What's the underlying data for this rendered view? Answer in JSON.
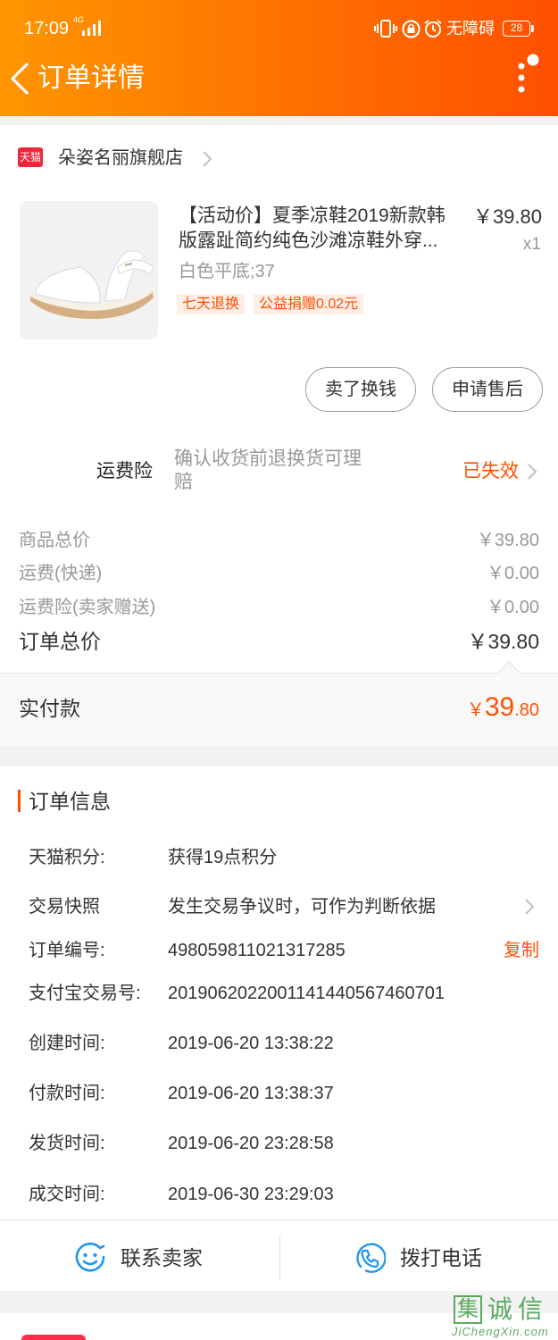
{
  "status_bar": {
    "time": "17:09",
    "network": "4G",
    "accessibility": "无障碍",
    "battery": "28"
  },
  "header": {
    "title": "订单详情",
    "back_icon": "chevron-left-icon",
    "more_icon": "more-vertical-icon"
  },
  "store": {
    "badge": "天猫",
    "name": "朵姿名丽旗舰店"
  },
  "product": {
    "title": "【活动价】夏季凉鞋2019新款韩版露趾简约纯色沙滩凉鞋外穿...",
    "price": "￥39.80",
    "quantity": "x1",
    "sku": "白色平底;37",
    "tags": [
      "七天退换",
      "公益捐赠0.02元"
    ]
  },
  "actions": {
    "resell": "卖了换钱",
    "after_sale": "申请售后"
  },
  "shipping_insurance": {
    "label": "运费险",
    "description": "确认收货前退换货可理赔",
    "status": "已失效"
  },
  "price_summary": {
    "rows": [
      {
        "label": "商品总价",
        "value": "￥39.80"
      },
      {
        "label": "运费(快递)",
        "value": "￥0.00"
      },
      {
        "label": "运费险(卖家赠送)",
        "value": "￥0.00"
      }
    ],
    "total_label": "订单总价",
    "total_value": "￥39.80"
  },
  "payment": {
    "label": "实付款",
    "currency": "￥",
    "integer": "39",
    "decimal": ".80"
  },
  "order_info": {
    "title": "订单信息",
    "rows": [
      {
        "label": "天猫积分:",
        "value": "获得19点积分"
      },
      {
        "label": "交易快照",
        "value": "发生交易争议时，可作为判断依据"
      },
      {
        "label": "订单编号:",
        "value": "498059811021317285"
      },
      {
        "label": "支付宝交易号:",
        "value": "2019062022001141440567460701"
      },
      {
        "label": "创建时间:",
        "value": "2019-06-20 13:38:22"
      },
      {
        "label": "付款时间:",
        "value": "2019-06-20 13:38:37"
      },
      {
        "label": "发货时间:",
        "value": "2019-06-20 23:28:58"
      },
      {
        "label": "成交时间:",
        "value": "2019-06-30 23:29:03"
      }
    ],
    "copy_label": "复制"
  },
  "bottom_bar": {
    "contact": "联系卖家",
    "call": "拨打电话"
  },
  "watermark": {
    "logo_box": "集",
    "logo_rest": "诚信",
    "site": "JiChengXin.com"
  },
  "colors": {
    "accent": "#ff5000",
    "header_start": "#ff9500",
    "header_end": "#ff5000",
    "icon_blue": "#1e96f0",
    "tmall_red": "#f2243a",
    "watermark_green": "#3f9c45"
  }
}
